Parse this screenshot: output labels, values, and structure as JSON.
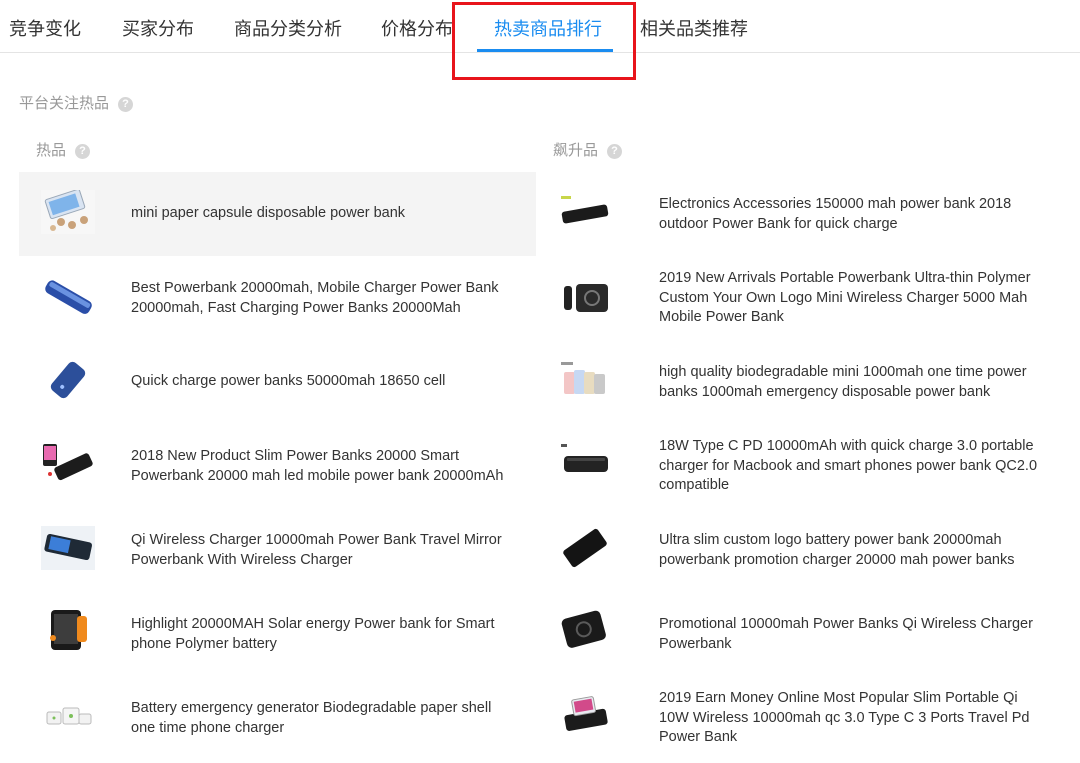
{
  "tabs": [
    {
      "label": "竞争变化",
      "active": false
    },
    {
      "label": "买家分布",
      "active": false
    },
    {
      "label": "商品分类分析",
      "active": false
    },
    {
      "label": "价格分布",
      "active": false
    },
    {
      "label": "热卖商品排行",
      "active": true
    },
    {
      "label": "相关品类推荐",
      "active": false
    }
  ],
  "section_title": "平台关注热品",
  "help_glyph": "?",
  "columns": {
    "hot": {
      "title": "热品",
      "items": [
        {
          "text": "mini paper capsule disposable power bank",
          "icon": "paper-capsule-power-bank-thumbnail"
        },
        {
          "text": "Best Powerbank 20000mah, Mobile Charger Power Bank 20000mah, Fast Charging Power Banks 20000Mah",
          "icon": "blue-slim-power-bank-thumbnail"
        },
        {
          "text": "Quick charge power banks 50000mah 18650 cell",
          "icon": "blue-power-bank-thumbnail"
        },
        {
          "text": "2018 New Product Slim Power Banks 20000 Smart Powerbank 20000 mah led mobile power bank 20000mAh",
          "icon": "black-led-power-bank-thumbnail"
        },
        {
          "text": "Qi Wireless Charger 10000mah Power Bank Travel Mirror Powerbank With Wireless Charger",
          "icon": "mirror-wireless-power-bank-thumbnail"
        },
        {
          "text": "Highlight 20000MAH Solar energy Power bank for Smart phone Polymer battery",
          "icon": "solar-power-bank-thumbnail"
        },
        {
          "text": "Battery emergency generator Biodegradable paper shell one time phone charger",
          "icon": "paper-shell-charger-thumbnail"
        }
      ]
    },
    "rising": {
      "title": "飙升品",
      "items": [
        {
          "text": "Electronics Accessories 150000 mah power bank 2018 outdoor Power Bank for quick charge",
          "icon": "black-flat-power-bank-thumbnail"
        },
        {
          "text": "2019 New Arrivals Portable Powerbank Ultra-thin Polymer Custom Your Own Logo Mini Wireless Charger 5000 Mah Mobile Power Bank",
          "icon": "wireless-charger-thumbnail"
        },
        {
          "text": "high quality biodegradable mini 1000mah one time power banks 1000mah emergency disposable power bank",
          "icon": "colorful-mini-power-banks-thumbnail"
        },
        {
          "text": "18W Type C PD 10000mAh with quick charge 3.0 portable charger for Macbook and smart phones power bank QC2.0 compatible",
          "icon": "black-type-c-power-bank-thumbnail"
        },
        {
          "text": "Ultra slim custom logo battery power bank 20000mah powerbank promotion charger 20000 mah power banks",
          "icon": "ultra-slim-power-bank-thumbnail"
        },
        {
          "text": "Promotional 10000mah Power Banks Qi Wireless Charger Powerbank",
          "icon": "qi-wireless-power-bank-thumbnail"
        },
        {
          "text": "2019 Earn Money Online Most Popular Slim Portable Qi 10W Wireless 10000mah qc 3.0 Type C 3 Ports Travel Pd Power Bank",
          "icon": "wireless-pad-phone-thumbnail"
        }
      ]
    }
  }
}
